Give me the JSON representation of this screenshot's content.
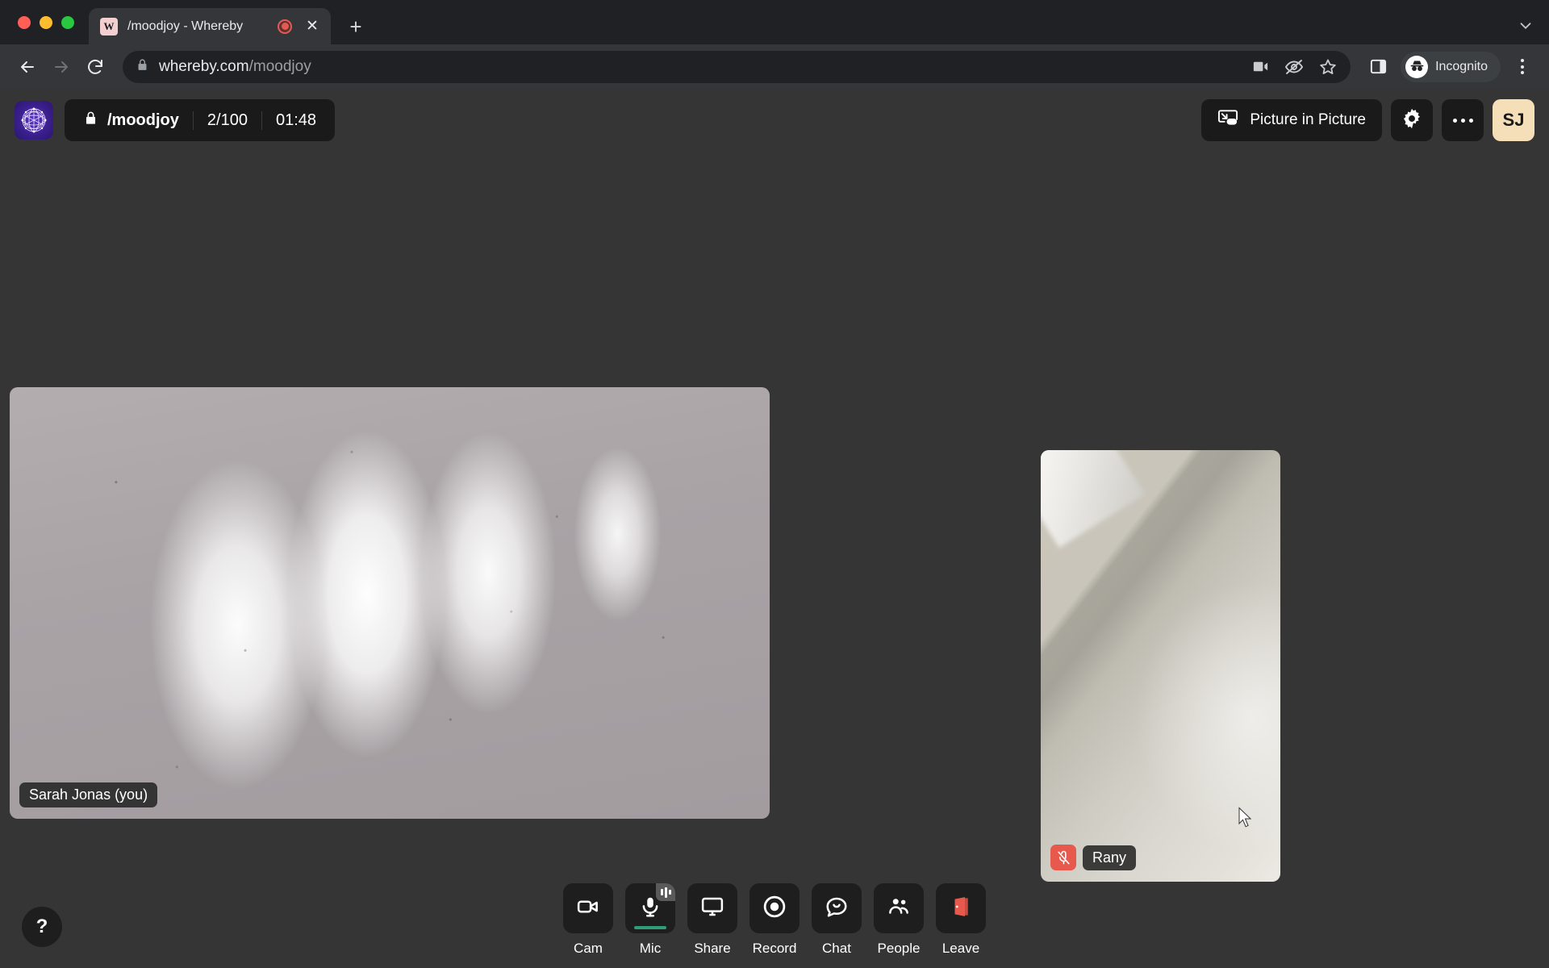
{
  "browser": {
    "window_controls": [
      "close",
      "minimize",
      "maximize"
    ],
    "tab": {
      "favicon_letter": "W",
      "title": "/moodjoy - Whereby",
      "recording_indicator": "tab-recording-dot",
      "close_label": "✕"
    },
    "new_tab_label": "+",
    "tabstrip_chevron": "⌄",
    "nav": {
      "back": "←",
      "forward": "→",
      "reload": "↻"
    },
    "omnibox": {
      "lock_icon": "lock-icon",
      "url_host": "whereby.com",
      "url_path": "/moodjoy",
      "actions": [
        "video-camera-icon",
        "eye-slash-icon",
        "star-icon"
      ]
    },
    "side_panel_icon": "side-panel-icon",
    "profile": {
      "label": "Incognito",
      "icon": "incognito-icon"
    },
    "menu_icon": "three-dot-menu-icon"
  },
  "app": {
    "logo": "whereby-room-logo",
    "room": {
      "lock_icon": "lock-icon",
      "name": "/moodjoy",
      "participants": "2/100",
      "timer": "01:48"
    },
    "header_actions": {
      "pip_label": "Picture in Picture",
      "pip_icon": "picture-in-picture-icon",
      "settings_icon": "gear-icon",
      "more_icon": "more-options-icon",
      "avatar_initials": "SJ"
    }
  },
  "participants": [
    {
      "name": "Sarah Jonas (you)",
      "muted": false,
      "is_self": true,
      "tile": "main"
    },
    {
      "name": "Rany",
      "muted": true,
      "mute_icon": "microphone-muted-icon",
      "is_self": false,
      "tile": "side"
    }
  ],
  "bottom_bar": {
    "help_label": "?",
    "controls": [
      {
        "label": "Cam",
        "icon": "video-camera-icon",
        "state": "on"
      },
      {
        "label": "Mic",
        "icon": "microphone-icon",
        "state": "on-active"
      },
      {
        "label": "Share",
        "icon": "screen-share-icon",
        "state": "off"
      },
      {
        "label": "Record",
        "icon": "record-icon",
        "state": "off"
      },
      {
        "label": "Chat",
        "icon": "chat-bubble-icon",
        "state": "off"
      },
      {
        "label": "People",
        "icon": "people-icon",
        "state": "off"
      },
      {
        "label": "Leave",
        "icon": "leave-door-icon",
        "state": "danger"
      }
    ]
  },
  "colors": {
    "browser_chrome": "#202124",
    "toolbar": "#35363a",
    "app_background": "#353535",
    "pill_background": "#1a1a1a",
    "avatar_background": "#f5dfb8",
    "mute_badge": "#e8594d",
    "mic_active": "#2f9c7a",
    "leave_icon": "#e8594d",
    "logo_purple": "#3a1f8c"
  }
}
